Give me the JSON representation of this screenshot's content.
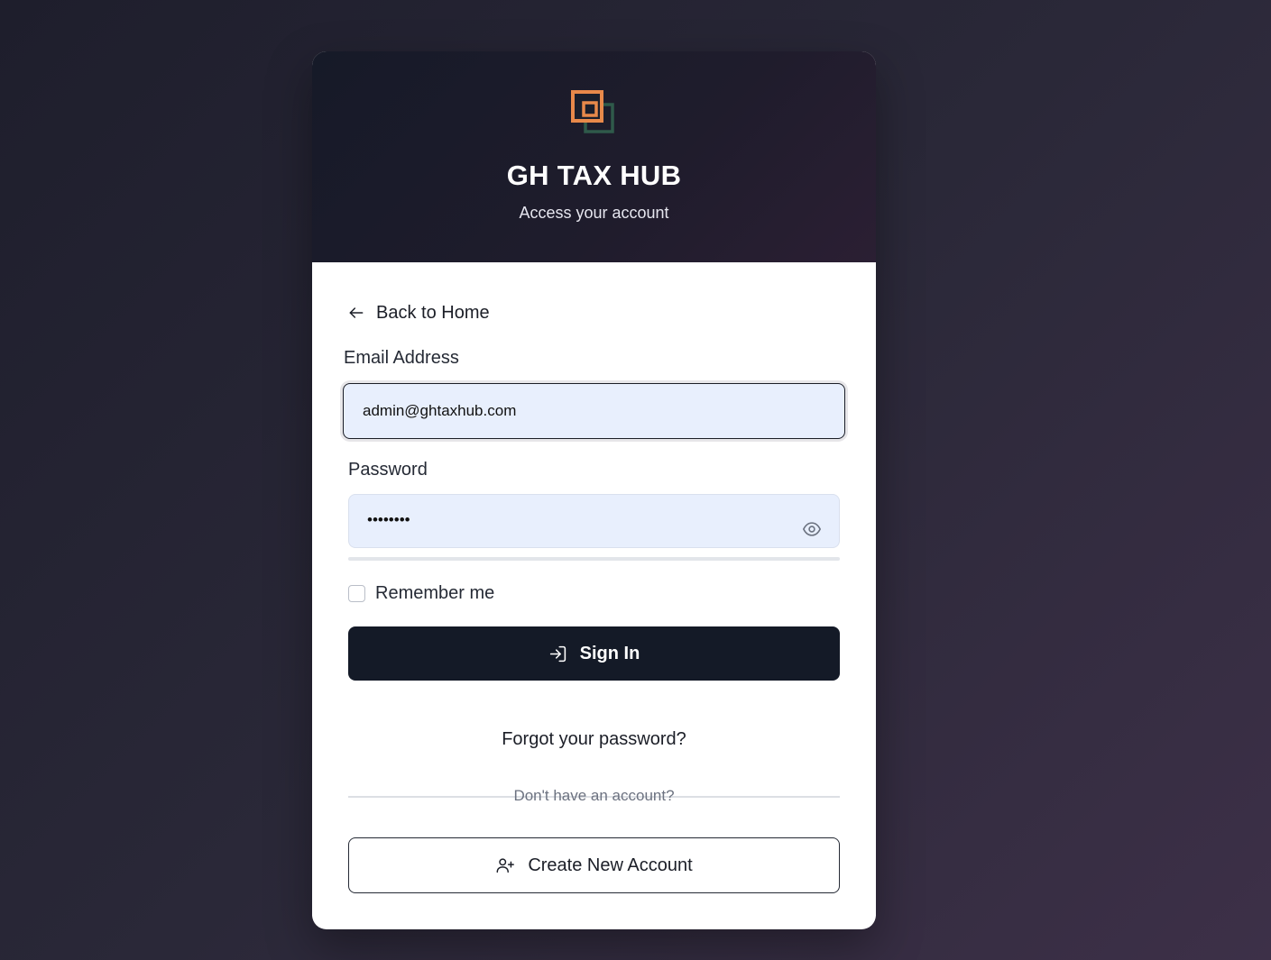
{
  "brand": {
    "name": "GH TAX HUB",
    "subtitle": "Access your account",
    "logo_icon": "overlapping-squares-logo"
  },
  "nav": {
    "back_label": "Back to Home",
    "back_icon": "arrow-left-icon"
  },
  "form": {
    "email_label": "Email Address",
    "email_value": "admin@ghtaxhub.com",
    "password_label": "Password",
    "password_value": "••••••••",
    "password_toggle_icon": "eye-icon",
    "remember_label": "Remember me",
    "remember_checked": false,
    "signin_label": "Sign In",
    "signin_icon": "log-in-icon"
  },
  "footer": {
    "forgot_label": "Forgot your password?",
    "no_account_text": "Don't have an account?",
    "create_label": "Create New Account",
    "create_icon": "user-plus-icon"
  },
  "colors": {
    "logo_orange": "#e8894a",
    "logo_green": "#2f5a4a",
    "primary_button": "#141a27",
    "input_bg": "#e8effd"
  }
}
